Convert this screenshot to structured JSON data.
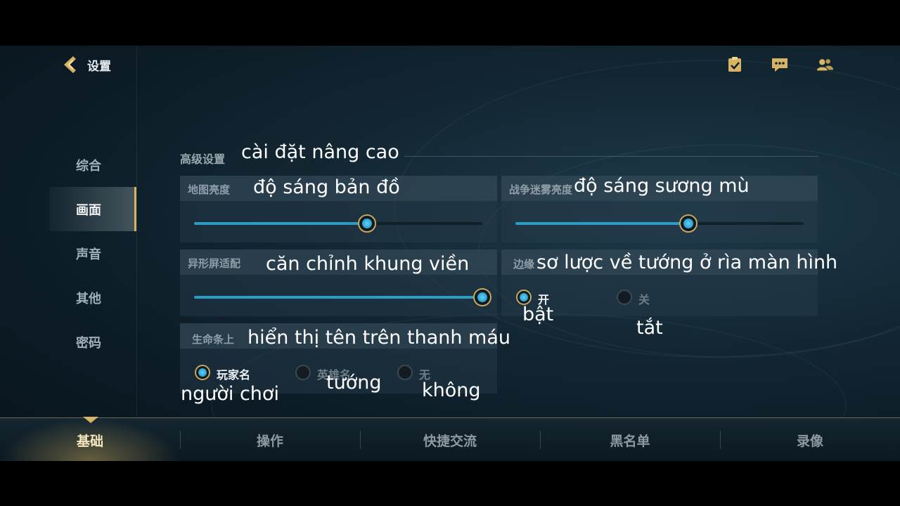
{
  "header": {
    "title": "设置",
    "icons": [
      "checklist-icon",
      "chat-icon",
      "friends-icon"
    ]
  },
  "sidebar": {
    "items": [
      {
        "label": "综合"
      },
      {
        "label": "画面"
      },
      {
        "label": "声音"
      },
      {
        "label": "其他"
      },
      {
        "label": "密码"
      }
    ],
    "active_index": 1
  },
  "section": {
    "title": "高级设置",
    "subtitle": "cài đặt nâng cao"
  },
  "map_brightness": {
    "label": "地图亮度",
    "subtitle": "độ sáng bản đồ",
    "value_percent": 60
  },
  "fog_brightness": {
    "label": "战争迷雾亮度",
    "subtitle": "độ sáng sương mù",
    "value_percent": 60
  },
  "notch_adapt": {
    "label": "异形屏适配",
    "subtitle": "căn chỉnh khung viền",
    "value_percent": 100
  },
  "edge_hero": {
    "label": "边缘",
    "subtitle": "sơ lược về tướng ở rìa màn hình",
    "options": [
      {
        "label": "开",
        "subtitle": "bật",
        "selected": true
      },
      {
        "label": "关",
        "subtitle": "tắt",
        "selected": false
      }
    ]
  },
  "health_bar_name": {
    "label": "生命条上",
    "subtitle": "hiển thị tên trên thanh máu",
    "options": [
      {
        "label": "玩家名",
        "subtitle": "người chơi",
        "selected": true
      },
      {
        "label": "英雄名",
        "subtitle": "tướng",
        "selected": false
      },
      {
        "label": "无",
        "subtitle": "không",
        "selected": false
      }
    ]
  },
  "tabs": [
    {
      "label": "基础"
    },
    {
      "label": "操作"
    },
    {
      "label": "快捷交流"
    },
    {
      "label": "黑名单"
    },
    {
      "label": "录像"
    }
  ],
  "colors": {
    "accent_gold": "#c8a65a",
    "slider_blue": "#2d9cc4",
    "background": "#0b1a24"
  }
}
